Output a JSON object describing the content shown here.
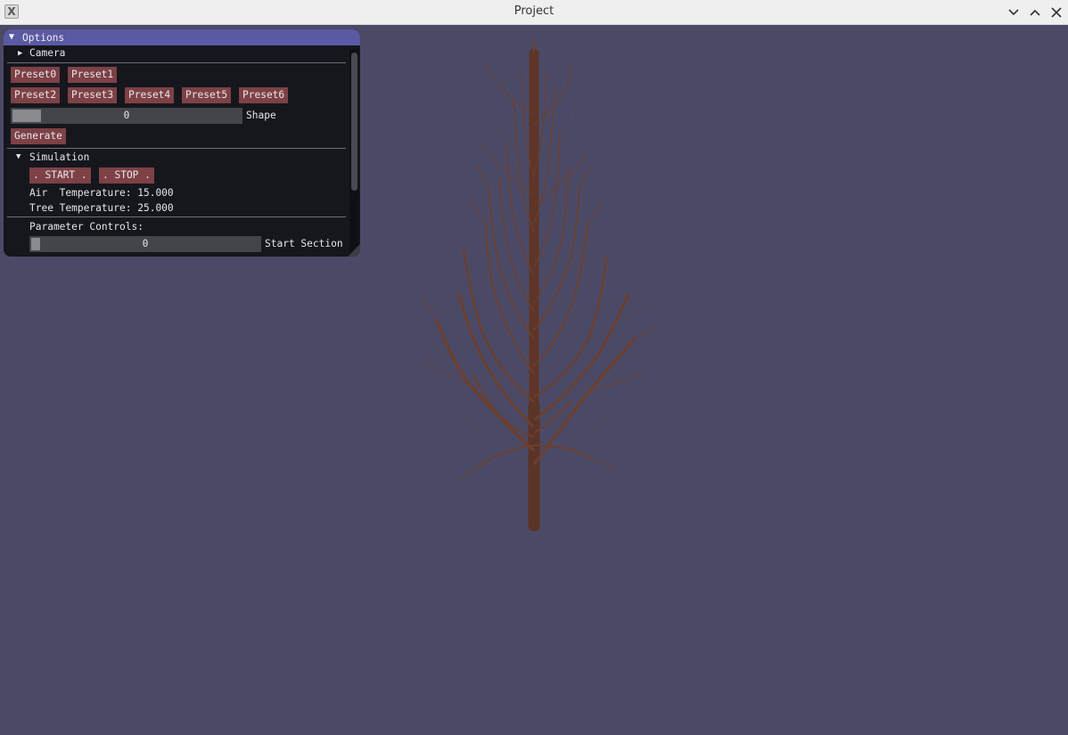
{
  "window": {
    "title": "Project",
    "app_icon": "x-app-icon",
    "controls": [
      "chevron-down-icon",
      "chevron-up-icon",
      "close-icon"
    ]
  },
  "panel": {
    "title": "Options",
    "camera_label": "Camera",
    "presets_row1": [
      "Preset0",
      "Preset1"
    ],
    "presets_row2": [
      "Preset2",
      "Preset3",
      "Preset4",
      "Preset5",
      "Preset6"
    ],
    "shape_slider": {
      "value": "0",
      "label": "Shape"
    },
    "generate_label": "Generate",
    "simulation": {
      "label": "Simulation",
      "start_label": ". START .",
      "stop_label": ". STOP .",
      "air_temp": "Air  Temperature: 15.000",
      "tree_temp": "Tree Temperature: 25.000"
    },
    "parameter_label": "Parameter Controls:",
    "start_section": {
      "value": "0",
      "label": "Start Section"
    }
  },
  "colors": {
    "background": "#4b4a66",
    "panel_title": "#5a59a3",
    "button": "#7d4146",
    "bark": "#6b3f30"
  }
}
